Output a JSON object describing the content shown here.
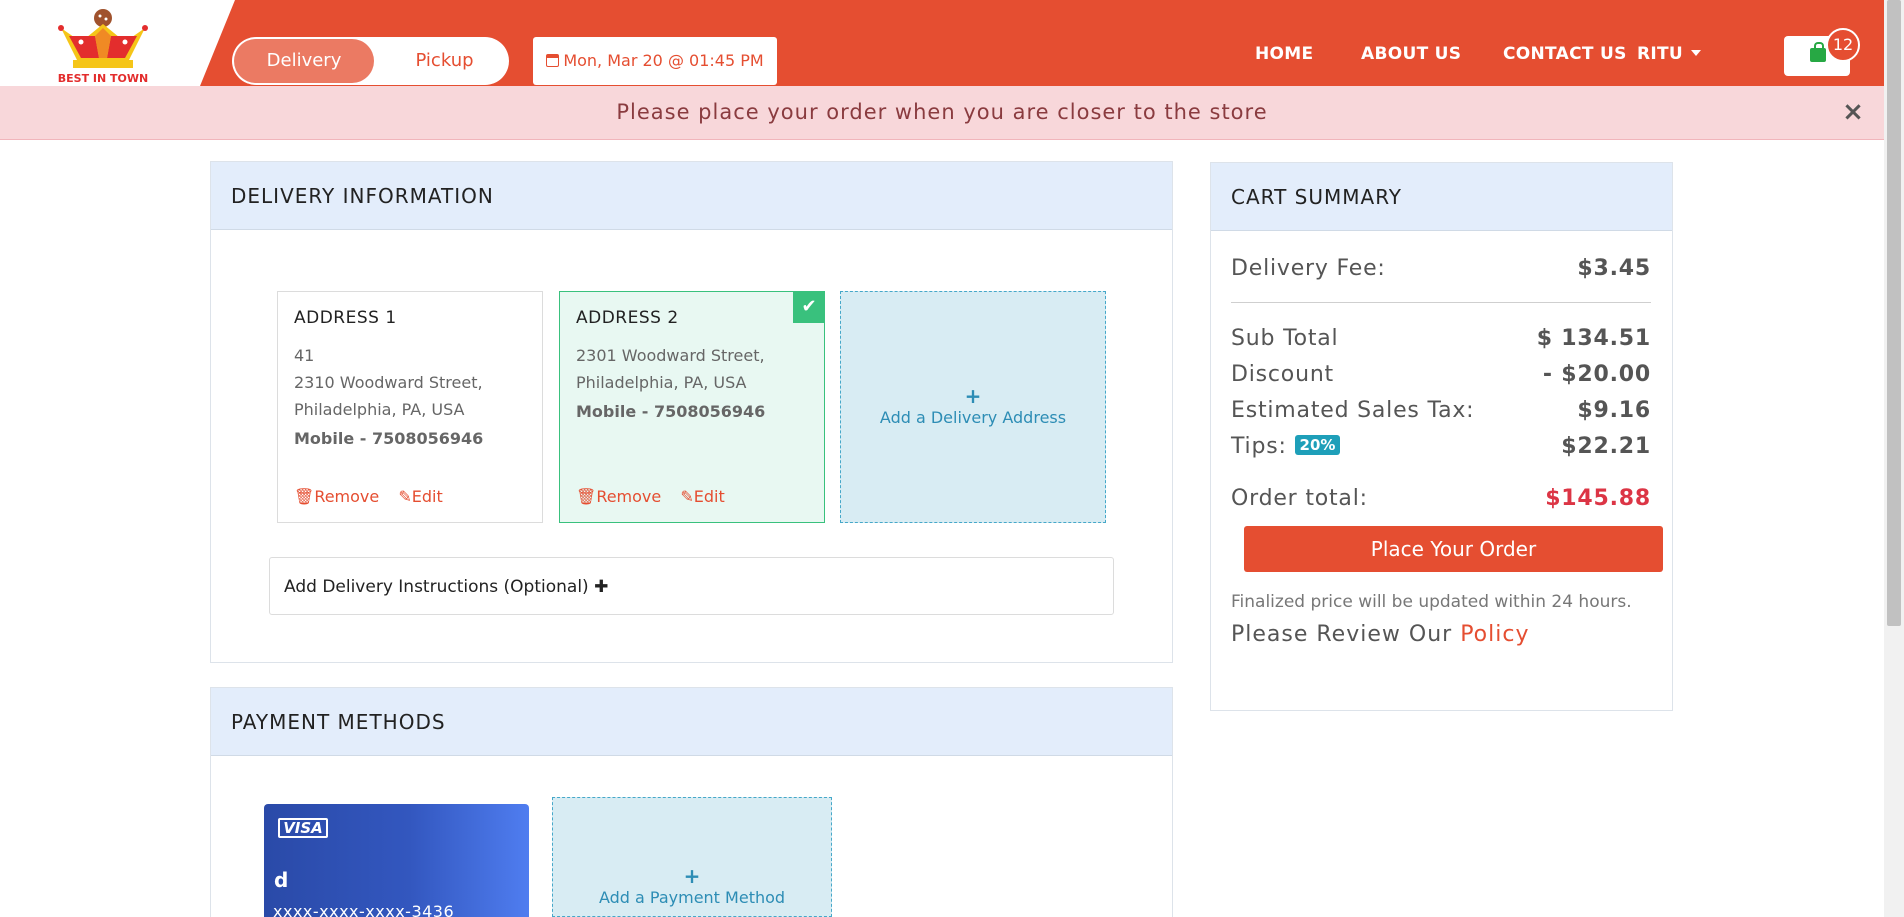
{
  "header": {
    "logo_text": "BEST IN TOWN",
    "mode": {
      "delivery_label": "Delivery",
      "pickup_label": "Pickup",
      "active": "Delivery"
    },
    "schedule_label": "Mon, Mar 20 @ 01:45 PM",
    "nav": [
      {
        "label": "HOME"
      },
      {
        "label": "ABOUT US"
      },
      {
        "label": "CONTACT US"
      },
      {
        "label": "RITU"
      }
    ],
    "cart_count": "12"
  },
  "alert": {
    "message": "Please place your order when you are closer to the store",
    "close_glyph": "×"
  },
  "delivery": {
    "title": "DELIVERY INFORMATION",
    "addresses": [
      {
        "title": "ADDRESS 1",
        "line1": "41",
        "line2": "2310 Woodward Street,",
        "line3": "Philadelphia, PA, USA",
        "mobile": "Mobile - 7508056946",
        "remove_label": "Remove",
        "edit_label": "Edit",
        "selected": false
      },
      {
        "title": "ADDRESS 2",
        "line1": "2301 Woodward Street,",
        "line2": "Philadelphia, PA, USA",
        "mobile": "Mobile - 7508056946",
        "remove_label": "Remove",
        "edit_label": "Edit",
        "selected": true
      }
    ],
    "add_address_plus": "+",
    "add_address_label": "Add a Delivery Address",
    "instructions_label": "Add Delivery Instructions (Optional)",
    "instructions_plus": "✚"
  },
  "cart_summary": {
    "title": "CART SUMMARY",
    "delivery_fee_label": "Delivery Fee:",
    "delivery_fee": "$3.45",
    "subtotal_label": "Sub Total",
    "subtotal": "$ 134.51",
    "discount_label": "Discount",
    "discount": "- $20.00",
    "tax_label": "Estimated Sales Tax:",
    "tax": "$9.16",
    "tips_label": "Tips:",
    "tips_percent": "20%",
    "tips": "$22.21",
    "total_label": "Order total:",
    "total": "$145.88",
    "place_order_label": "Place Your Order",
    "note": "Finalized price will be updated within 24 hours.",
    "policy_prefix": "Please Review Our",
    "policy_link": "Policy",
    "colors": {
      "total": "#dc3545",
      "accent": "#e54e31"
    }
  },
  "payment": {
    "title": "PAYMENT METHODS",
    "card_brand": "VISA",
    "card_name": "d",
    "card_number": "xxxx-xxxx-xxxx-3436",
    "add_plus": "+",
    "add_label": "Add a Payment Method"
  },
  "theme": {
    "brand": "#e54e31",
    "panel_header": "#e3edfb",
    "selected_border": "#39c17d"
  }
}
